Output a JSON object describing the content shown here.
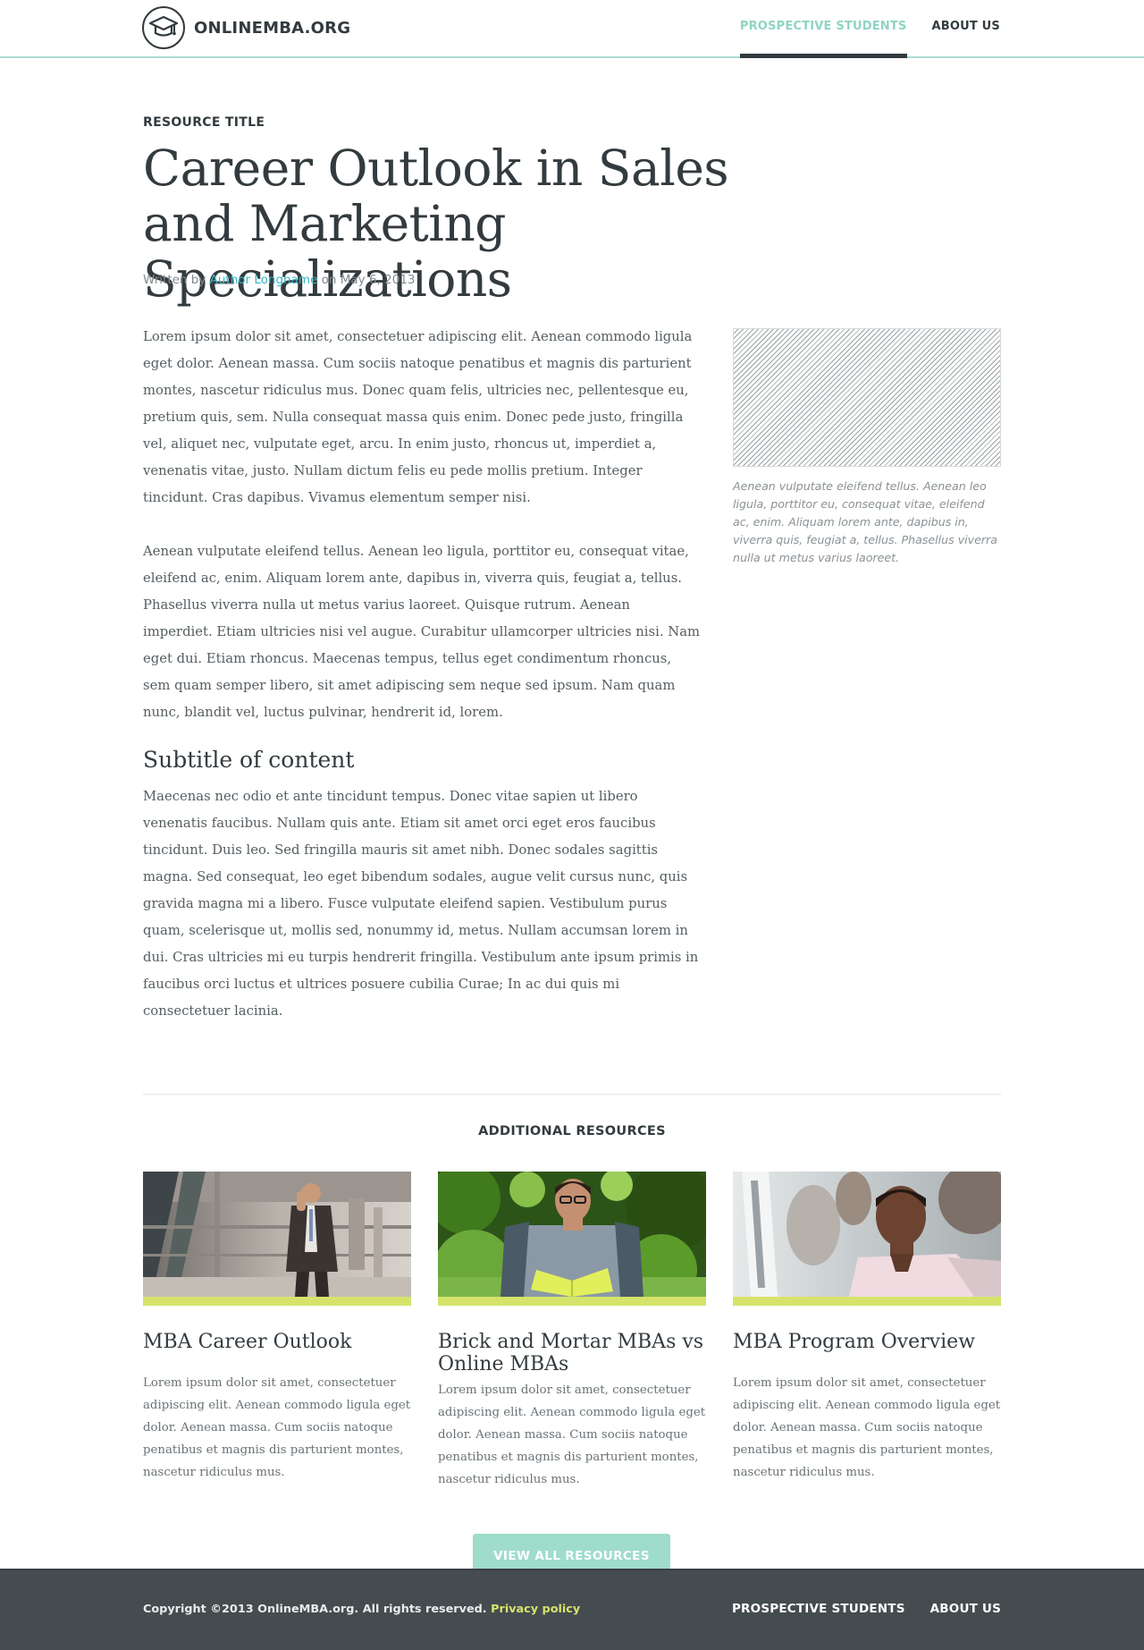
{
  "header": {
    "logo_text": "ONLINEMBA.ORG",
    "nav": [
      {
        "label": "PROSPECTIVE STUDENTS",
        "active": true
      },
      {
        "label": "ABOUT US",
        "active": false
      }
    ]
  },
  "article": {
    "eyebrow": "RESOURCE TITLE",
    "title": "Career Outlook in Sales and Marketing Specializations",
    "byline_prefix": "Written by",
    "author": "Author Longname",
    "byline_mid": "on",
    "date": "May 6, 2013",
    "paragraphs": [
      "Lorem ipsum dolor sit amet, consectetuer adipiscing elit. Aenean commodo ligula eget dolor. Aenean massa. Cum sociis natoque penatibus et magnis dis parturient montes, nascetur ridiculus mus. Donec quam felis, ultricies nec, pellentesque eu, pretium quis, sem. Nulla consequat massa quis enim. Donec pede justo, fringilla vel, aliquet nec, vulputate eget, arcu. In enim justo, rhoncus ut, imperdiet a, venenatis vitae, justo. Nullam dictum felis eu pede mollis pretium. Integer tincidunt. Cras dapibus. Vivamus elementum semper nisi.",
      "Aenean vulputate eleifend tellus. Aenean leo ligula, porttitor eu, consequat vitae, eleifend ac, enim. Aliquam lorem ante, dapibus in, viverra quis, feugiat a, tellus. Phasellus viverra nulla ut metus varius laoreet. Quisque rutrum. Aenean imperdiet. Etiam ultricies nisi vel augue. Curabitur ullamcorper ultricies nisi. Nam eget dui. Etiam rhoncus. Maecenas tempus, tellus eget condimentum rhoncus, sem quam semper libero, sit amet adipiscing sem neque sed ipsum. Nam quam nunc, blandit vel, luctus pulvinar, hendrerit id, lorem."
    ],
    "subtitle": "Subtitle of content",
    "paragraph_after_subtitle": "Maecenas nec odio et ante tincidunt tempus. Donec vitae sapien ut libero venenatis faucibus. Nullam quis ante. Etiam sit amet orci eget eros faucibus tincidunt. Duis leo. Sed fringilla mauris sit amet nibh. Donec sodales sagittis magna. Sed consequat, leo eget bibendum sodales, augue velit cursus nunc, quis gravida magna mi a libero. Fusce vulputate eleifend sapien. Vestibulum purus quam, scelerisque ut, mollis sed, nonummy id, metus. Nullam accumsan lorem in dui. Cras ultricies mi eu turpis hendrerit fringilla. Vestibulum ante ipsum primis in faucibus orci luctus et ultrices posuere cubilia Curae; In ac dui quis mi consectetuer lacinia.",
    "image_caption": "Aenean vulputate eleifend tellus. Aenean leo ligula, porttitor eu, consequat vitae, eleifend ac, enim. Aliquam lorem ante, dapibus in, viverra quis, feugiat a, tellus. Phasellus viverra nulla ut metus varius laoreet."
  },
  "resources": {
    "heading": "ADDITIONAL RESOURCES",
    "cards": [
      {
        "title": "MBA Career Outlook",
        "text": "Lorem ipsum dolor sit amet, consectetuer adipiscing elit. Aenean commodo ligula eget dolor. Aenean massa. Cum sociis natoque penatibus et magnis dis parturient montes, nascetur ridiculus mus."
      },
      {
        "title": "Brick and Mortar MBAs vs Online MBAs",
        "text": "Lorem ipsum dolor sit amet, consectetuer adipiscing elit. Aenean commodo ligula eget dolor. Aenean massa. Cum sociis natoque penatibus et magnis dis parturient montes, nascetur ridiculus mus."
      },
      {
        "title": "MBA Program Overview",
        "text": "Lorem ipsum dolor sit amet, consectetuer adipiscing elit. Aenean commodo ligula eget dolor. Aenean massa. Cum sociis natoque penatibus et magnis dis parturient montes, nascetur ridiculus mus."
      }
    ],
    "cta_label": "VIEW ALL RESOURCES"
  },
  "footer": {
    "copyright": "Copyright ©2013 OnlineMBA.org. All rights reserved.",
    "privacy_label": "Privacy policy",
    "nav": [
      {
        "label": "PROSPECTIVE STUDENTS"
      },
      {
        "label": "ABOUT US"
      }
    ]
  },
  "colors": {
    "accent_teal": "#8fd3c3",
    "link_blue": "#35b5c4",
    "lime": "#d6e36b",
    "footer_bg": "#454c4f",
    "text_dark": "#333b3f"
  },
  "icons": {
    "logo": "graduation-cap-icon"
  }
}
